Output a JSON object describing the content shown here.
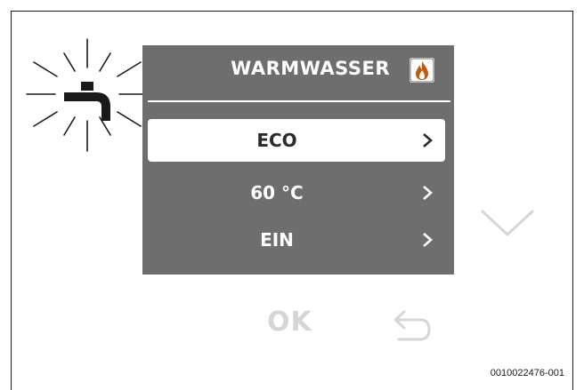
{
  "screen": {
    "title": "WARMWASSER",
    "title_icon": "flame-icon",
    "menu": [
      {
        "label": "ECO",
        "selected": true,
        "icon": "chevron-right-icon"
      },
      {
        "label": "60 °C",
        "selected": false,
        "icon": "chevron-right-icon"
      },
      {
        "label": "EIN",
        "selected": false,
        "icon": "chevron-right-icon"
      }
    ]
  },
  "keys": {
    "ok_label": "OK",
    "down_icon": "chevron-down-icon",
    "back_icon": "back-arrow-icon",
    "tap_icon": "water-tap-icon"
  },
  "figure_id": "0010022476-001",
  "colors": {
    "screen_bg": "#6e6e6e",
    "selected_row_bg": "#ffffff",
    "inactive_key": "#d6d6d6",
    "flame": "#c25a0e"
  }
}
